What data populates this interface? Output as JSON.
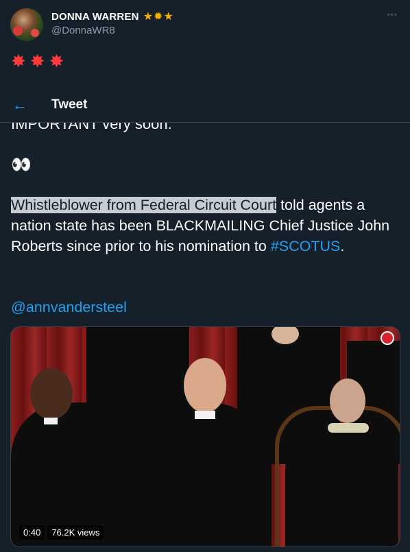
{
  "profile": {
    "display_name": "DONNA WARREN",
    "badges": "★✹★",
    "handle": "@DonnaWR8",
    "more": "◦◦◦",
    "bio_emojis": "✸✸✸"
  },
  "topbar": {
    "back": "←",
    "title": "Tweet"
  },
  "tweet": {
    "partial_line": "IMPORTANT very soon.",
    "eyes": "👀",
    "highlight": "Whistleblower from Federal Circuit Court",
    "rest": " told agents a nation state has been BLACKMAILING Chief Justice John Roberts since prior to his nomination to ",
    "hashtag": "#SCOTUS",
    "period": ".",
    "mention": "@annvandersteel"
  },
  "media": {
    "duration": "0:40",
    "views": "76.2K views"
  },
  "colors": {
    "background": "#15202b",
    "accent": "#1da1f2",
    "muted": "#8899a6",
    "border": "#38444d"
  }
}
